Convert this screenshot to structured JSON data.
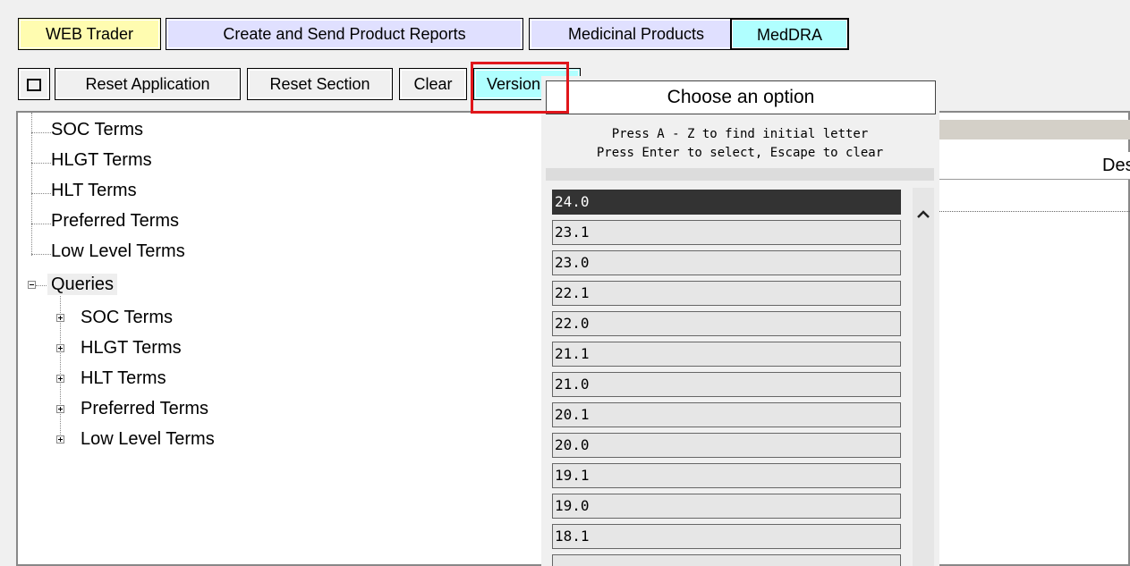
{
  "tabs": [
    {
      "label": "WEB Trader",
      "color": "#fffcb0"
    },
    {
      "label": "Create and Send Product Reports",
      "color": "#e0e0ff"
    },
    {
      "label": "Medicinal Products",
      "color": "#e0e0ff"
    },
    {
      "label": "MedDRA",
      "color": "#b0ffff"
    }
  ],
  "toolbar": {
    "square_icon": "□",
    "reset_application": "Reset Application",
    "reset_section": "Reset Section",
    "clear": "Clear",
    "version": "Version"
  },
  "tree": {
    "top_items": [
      "SOC Terms",
      "HLGT Terms",
      "HLT Terms",
      "Preferred Terms",
      "Low Level Terms"
    ],
    "queries_label": "Queries",
    "query_items": [
      "SOC Terms",
      "HLGT Terms",
      "HLT Terms",
      "Preferred Terms",
      "Low Level Terms"
    ]
  },
  "grid": {
    "column_header": "Desc"
  },
  "dropdown": {
    "title": "Choose an option",
    "hint1": "Press A - Z to find initial letter",
    "hint2": "Press Enter to select, Escape to clear",
    "selected": "24.0",
    "options": [
      "24.0",
      "23.1",
      "23.0",
      "22.1",
      "22.0",
      "21.1",
      "21.0",
      "20.1",
      "20.0",
      "19.1",
      "19.0",
      "18.1"
    ]
  },
  "colors": {
    "highlight_box": "#e0161b",
    "selected_option_bg": "#333333"
  }
}
